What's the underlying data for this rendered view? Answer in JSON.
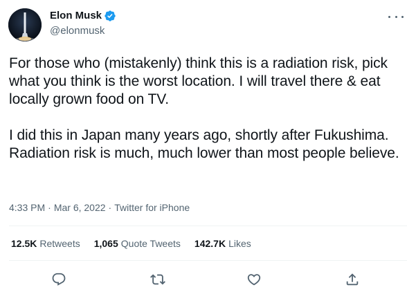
{
  "user": {
    "name": "Elon Musk",
    "handle": "@elonmusk",
    "verified": true
  },
  "tweet": {
    "paragraphs": [
      "For those who (mistakenly) think this is a radiation risk, pick what you think is the worst location. I will travel there & eat locally grown food on TV.",
      "I did this in Japan many years ago, shortly after Fukushima. Radiation risk is much, much lower than most people believe."
    ],
    "time": "4:33 PM",
    "date": "Mar 6, 2022",
    "source": "Twitter for iPhone",
    "separator": "·"
  },
  "stats": {
    "retweets_count": "12.5K",
    "retweets_label": "Retweets",
    "quotes_count": "1,065",
    "quotes_label": "Quote Tweets",
    "likes_count": "142.7K",
    "likes_label": "Likes"
  },
  "icons": {
    "verified": "verified-badge-icon",
    "more": "more-icon",
    "reply": "reply-icon",
    "retweet": "retweet-icon",
    "like": "heart-icon",
    "share": "share-icon"
  },
  "colors": {
    "text": "#0f1419",
    "secondary": "#536471",
    "verified": "#1d9bf0",
    "divider": "#eff3f4"
  }
}
